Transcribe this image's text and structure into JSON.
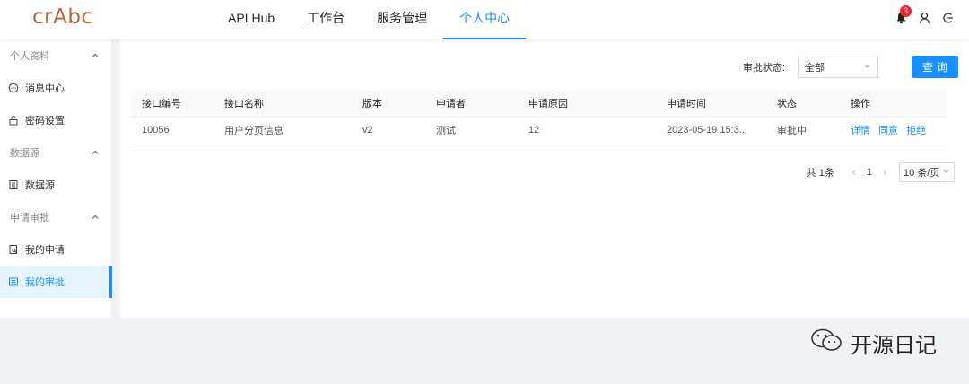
{
  "logo": "crAbc",
  "nav": {
    "items": [
      {
        "label": "API Hub"
      },
      {
        "label": "工作台"
      },
      {
        "label": "服务管理"
      },
      {
        "label": "个人中心"
      }
    ],
    "active_index": 3
  },
  "header": {
    "notification_count": "3",
    "icons": [
      "bell-icon",
      "user-icon",
      "logout-icon"
    ]
  },
  "sidebar": {
    "groups": [
      {
        "label": "个人资料",
        "items": [
          {
            "label": "消息中心",
            "icon": "message-icon"
          },
          {
            "label": "密码设置",
            "icon": "lock-icon"
          }
        ]
      },
      {
        "label": "数据源",
        "items": [
          {
            "label": "数据源",
            "icon": "list-icon"
          }
        ]
      },
      {
        "label": "申请审批",
        "items": [
          {
            "label": "我的申请",
            "icon": "file-search-icon"
          },
          {
            "label": "我的审批",
            "icon": "audit-icon"
          }
        ]
      }
    ],
    "active_item": "我的审批"
  },
  "filter": {
    "label": "审批状态:",
    "value": "全部",
    "query_button": "查询"
  },
  "table": {
    "columns": [
      "接口编号",
      "接口名称",
      "版本",
      "申请者",
      "申请原因",
      "申请时间",
      "状态",
      "操作"
    ],
    "rows": [
      {
        "id": "10056",
        "name": "用户分页信息",
        "version": "v2",
        "applicant": "测试",
        "reason": "12",
        "time": "2023-05-19 15:3...",
        "status": "审批中",
        "actions": [
          "详情",
          "同意",
          "拒绝"
        ]
      }
    ]
  },
  "pagination": {
    "total": "共 1条",
    "current_page": "1",
    "page_size": "10 条/页"
  },
  "watermark": "开源日记",
  "colors": {
    "primary": "#1890ff",
    "logo": "#b5683c",
    "badge": "#f5222d"
  }
}
